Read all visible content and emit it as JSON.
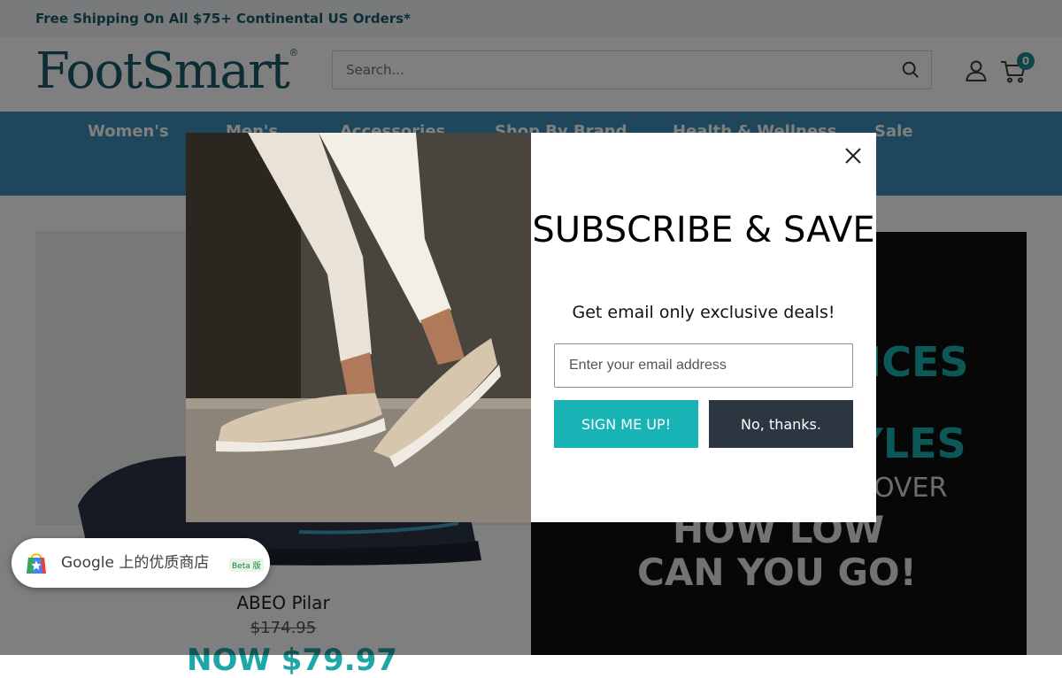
{
  "announcement": {
    "text": "Free Shipping On All $75+ Continental US Orders*"
  },
  "header": {
    "logo_text": "FootSmart",
    "logo_mark": "®",
    "search_placeholder": "Search...",
    "search_icon": "search-icon",
    "account_icon": "account-icon",
    "cart_icon": "cart-icon",
    "cart_count": "0"
  },
  "nav": {
    "items": [
      {
        "label": "Women's"
      },
      {
        "label": "Men's"
      },
      {
        "label": "Accessories"
      },
      {
        "label": "Shop By Brand"
      },
      {
        "label": "Health & Wellness"
      },
      {
        "label": "Sale"
      }
    ]
  },
  "product": {
    "name": "ABEO Pilar",
    "old_price": "$174.95",
    "now_price": "NOW $79.97"
  },
  "promo": {
    "line1": "PRICES",
    "line2": "STYLES",
    "line3": "DISCOVER",
    "line4": "HOW LOW",
    "line5": "CAN YOU GO!"
  },
  "modal": {
    "title": "SUBSCRIBE & SAVE",
    "subtitle": "Get email only exclusive deals!",
    "email_placeholder": "Enter your email address",
    "primary_button": "SIGN ME UP!",
    "secondary_button": "No, thanks.",
    "close_icon": "close-icon"
  },
  "google_chip": {
    "text": "Google 上的优质商店",
    "beta": "Beta 版",
    "icon": "shopping-bag-icon"
  },
  "colors": {
    "brand": "#1a5b6a",
    "nav": "#3f8fb7",
    "accent": "#17b3b5",
    "dark_button": "#2b3641"
  }
}
